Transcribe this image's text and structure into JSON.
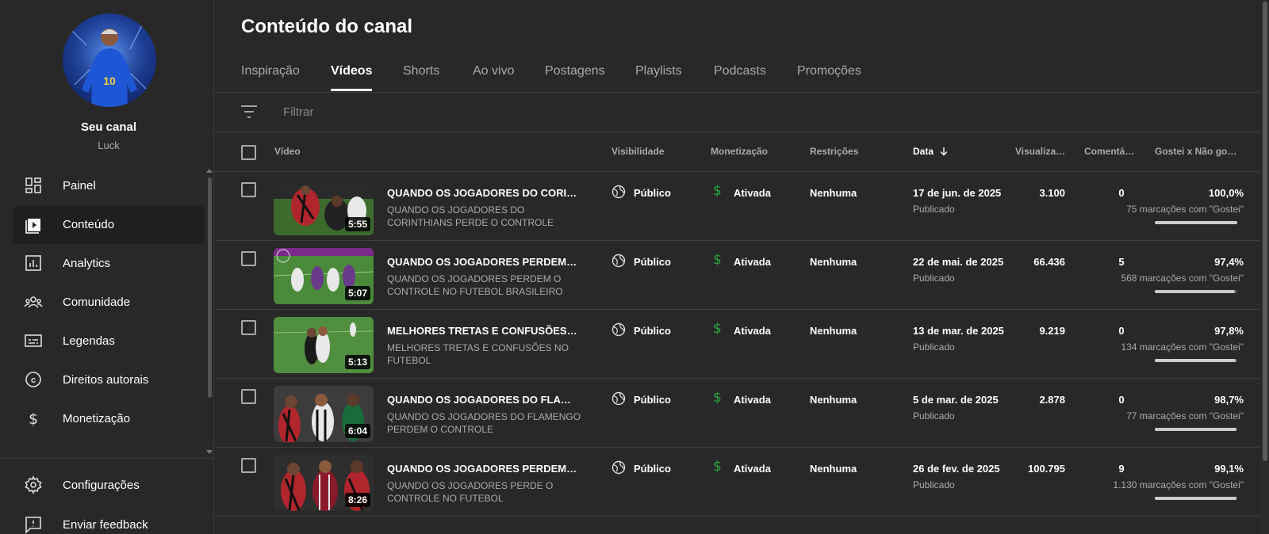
{
  "sidebar": {
    "channel_title": "Seu canal",
    "channel_handle": "Luck",
    "items": [
      {
        "label": "Painel",
        "icon": "dashboard-icon"
      },
      {
        "label": "Conteúdo",
        "icon": "content-icon"
      },
      {
        "label": "Analytics",
        "icon": "analytics-icon"
      },
      {
        "label": "Comunidade",
        "icon": "community-icon"
      },
      {
        "label": "Legendas",
        "icon": "subtitles-icon"
      },
      {
        "label": "Direitos autorais",
        "icon": "copyright-icon"
      },
      {
        "label": "Monetização",
        "icon": "dollar-icon"
      }
    ],
    "active_item": "Conteúdo",
    "footer_items": [
      {
        "label": "Configurações",
        "icon": "gear-icon"
      },
      {
        "label": "Enviar feedback",
        "icon": "feedback-icon"
      }
    ]
  },
  "main": {
    "title": "Conteúdo do canal",
    "tabs": [
      "Inspiração",
      "Vídeos",
      "Shorts",
      "Ao vivo",
      "Postagens",
      "Playlists",
      "Podcasts",
      "Promoções"
    ],
    "active_tab": "Vídeos",
    "filter_placeholder": "Filtrar",
    "columns": {
      "video": "Vídeo",
      "visibility": "Visibilidade",
      "monetization": "Monetização",
      "restrictions": "Restrições",
      "date": "Data",
      "views": "Visualiza…",
      "comments": "Comentá…",
      "likes": "Gostei x Não go…"
    },
    "sort_column": "Data",
    "sort_direction": "descending",
    "rows": [
      {
        "duration": "5:55",
        "title": "QUANDO OS JOGADORES DO CORINT…",
        "description": "QUANDO OS JOGADORES DO CORINTHIANS PERDE O CONTROLE",
        "visibility": "Público",
        "monetization": "Ativada",
        "restrictions": "Nenhuma",
        "date": "17 de jun. de 2025",
        "status": "Publicado",
        "views": "3.100",
        "comments": "0",
        "likes_pct": "100,0%",
        "likes_count": "75 marcações com \"Gostei\"",
        "like_fraction": 1.0
      },
      {
        "duration": "5:07",
        "title": "QUANDO OS JOGADORES PERDEM O …",
        "description": "QUANDO OS JOGADORES PERDEM O CONTROLE NO FUTEBOL BRASILEIRO",
        "visibility": "Público",
        "monetization": "Ativada",
        "restrictions": "Nenhuma",
        "date": "22 de mai. de 2025",
        "status": "Publicado",
        "views": "66.436",
        "comments": "5",
        "likes_pct": "97,4%",
        "likes_count": "568 marcações com \"Gostei\"",
        "like_fraction": 0.974
      },
      {
        "duration": "5:13",
        "title": "MELHORES TRETAS E CONFUSÕES N…",
        "description": "MELHORES TRETAS E CONFUSÕES NO FUTEBOL",
        "visibility": "Público",
        "monetization": "Ativada",
        "restrictions": "Nenhuma",
        "date": "13 de mar. de 2025",
        "status": "Publicado",
        "views": "9.219",
        "comments": "0",
        "likes_pct": "97,8%",
        "likes_count": "134 marcações com \"Gostei\"",
        "like_fraction": 0.978
      },
      {
        "duration": "6:04",
        "title": "QUANDO OS JOGADORES DO FLAME…",
        "description": "QUANDO OS JOGADORES DO FLAMENGO PERDEM O CONTROLE",
        "visibility": "Público",
        "monetization": "Ativada",
        "restrictions": "Nenhuma",
        "date": "5 de mar. de 2025",
        "status": "Publicado",
        "views": "2.878",
        "comments": "0",
        "likes_pct": "98,7%",
        "likes_count": "77 marcações com \"Gostei\"",
        "like_fraction": 0.987
      },
      {
        "duration": "8:26",
        "title": "QUANDO OS JOGADORES PERDEM O …",
        "description": "QUANDO OS JOGADORES PERDE O CONTROLE NO FUTEBOL",
        "visibility": "Público",
        "monetization": "Ativada",
        "restrictions": "Nenhuma",
        "date": "26 de fev. de 2025",
        "status": "Publicado",
        "views": "100.795",
        "comments": "9",
        "likes_pct": "99,1%",
        "likes_count": "1.130 marcações com \"Gostei\"",
        "like_fraction": 0.991
      }
    ]
  },
  "colors": {
    "background": "#282828",
    "monetization_green": "#2ba640",
    "text_secondary": "#aaaaaa"
  }
}
